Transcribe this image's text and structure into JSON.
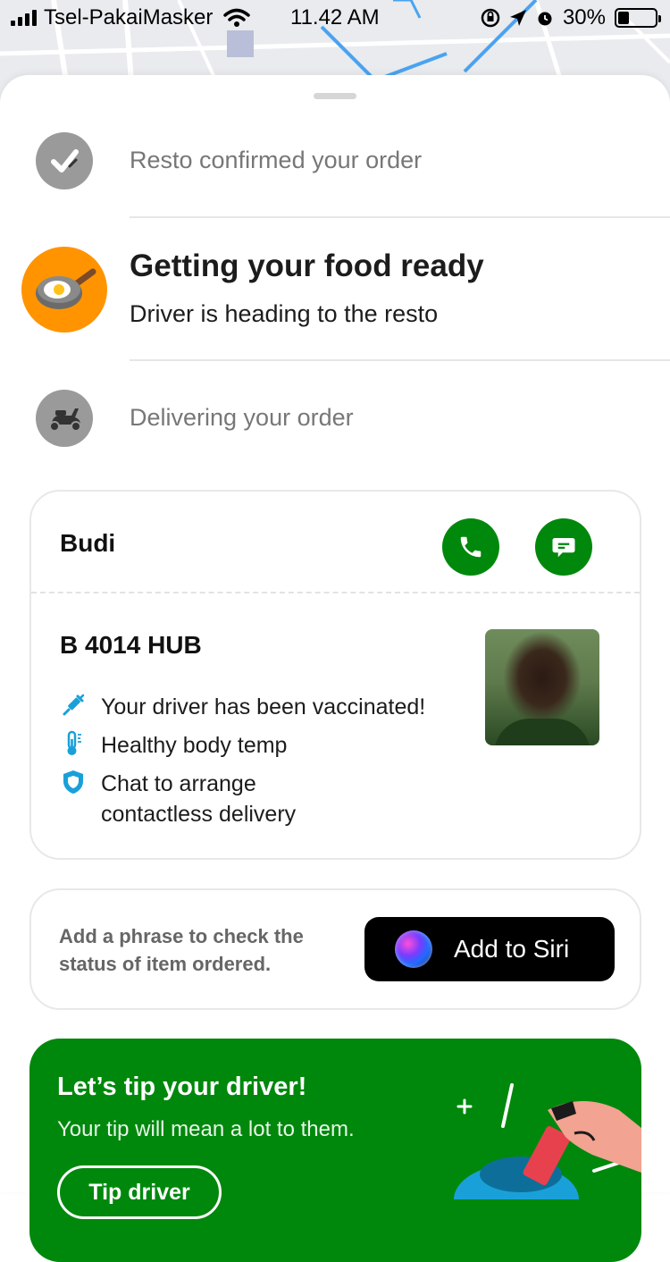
{
  "status_bar": {
    "carrier": "Tsel-PakaiMasker",
    "time": "11.42 AM",
    "battery": "30%"
  },
  "steps": [
    {
      "label": "Resto confirmed your order",
      "state": "done",
      "icon": "check-icon"
    },
    {
      "title": "Getting your food ready",
      "subtitle": "Driver is heading to the resto",
      "state": "active",
      "icon": "frying-pan-icon"
    },
    {
      "label": "Delivering your order",
      "state": "pending",
      "icon": "scooter-icon"
    }
  ],
  "driver_card": {
    "name": "Budi",
    "plate": "B 4014 HUB",
    "features": [
      {
        "icon": "syringe-icon",
        "text": "Your driver has been vaccinated!"
      },
      {
        "icon": "thermometer-icon",
        "text": "Healthy body temp"
      },
      {
        "icon": "shield-icon",
        "text": "Chat to arrange contactless delivery",
        "line1": "Chat to arrange",
        "line2": "contactless delivery"
      }
    ],
    "call_icon": "phone-icon",
    "chat_icon": "chat-icon"
  },
  "siri_card": {
    "description_line1": "Add a phrase to check the",
    "description_line2": "status of item ordered.",
    "button_label": "Add to Siri"
  },
  "tip_card": {
    "title": "Let’s tip your driver!",
    "subtitle": "Your tip will mean a lot to them.",
    "button_label": "Tip driver"
  },
  "colors": {
    "brand_green": "#00880c",
    "active_orange": "#ff9400",
    "accent_blue": "#1aa0d8"
  }
}
